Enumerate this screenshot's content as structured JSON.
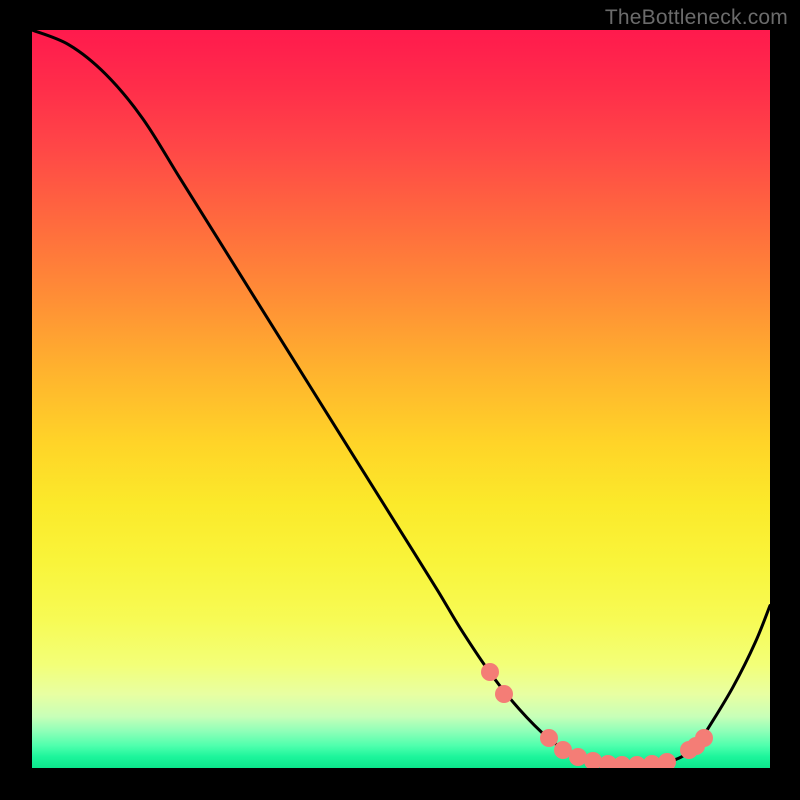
{
  "watermark": "TheBottleneck.com",
  "chart_data": {
    "type": "line",
    "title": "",
    "xlabel": "",
    "ylabel": "",
    "xlim": [
      0,
      100
    ],
    "ylim": [
      0,
      100
    ],
    "grid": false,
    "notes": "Gradient background from red (top) through orange/yellow to green (bottom). Curve is a bottleneck-percentage curve; minimum ~0 near x≈78. Salmon markers cluster along the near-zero flat region.",
    "x": [
      0,
      5,
      10,
      15,
      20,
      25,
      30,
      35,
      40,
      45,
      50,
      55,
      58,
      62,
      66,
      70,
      73,
      74,
      76,
      78,
      80,
      82,
      84,
      86,
      88,
      90,
      92,
      95,
      98,
      100
    ],
    "values": [
      100,
      98,
      94,
      88,
      80,
      72,
      64,
      56,
      48,
      40,
      32,
      24,
      19,
      13,
      8,
      4,
      2,
      1.5,
      1,
      0.6,
      0.4,
      0.4,
      0.5,
      0.8,
      1.5,
      3,
      6,
      11,
      17,
      22
    ],
    "series": [
      {
        "name": "bottleneck",
        "x": [
          0,
          5,
          10,
          15,
          20,
          25,
          30,
          35,
          40,
          45,
          50,
          55,
          58,
          62,
          66,
          70,
          73,
          74,
          76,
          78,
          80,
          82,
          84,
          86,
          88,
          90,
          92,
          95,
          98,
          100
        ],
        "values": [
          100,
          98,
          94,
          88,
          80,
          72,
          64,
          56,
          48,
          40,
          32,
          24,
          19,
          13,
          8,
          4,
          2,
          1.5,
          1,
          0.6,
          0.4,
          0.4,
          0.5,
          0.8,
          1.5,
          3,
          6,
          11,
          17,
          22
        ]
      }
    ],
    "markers": {
      "color": "#f47d76",
      "points": [
        {
          "x": 62,
          "y": 13
        },
        {
          "x": 64,
          "y": 10
        },
        {
          "x": 70,
          "y": 4
        },
        {
          "x": 72,
          "y": 2.5
        },
        {
          "x": 74,
          "y": 1.5
        },
        {
          "x": 76,
          "y": 1
        },
        {
          "x": 78,
          "y": 0.6
        },
        {
          "x": 80,
          "y": 0.4
        },
        {
          "x": 82,
          "y": 0.4
        },
        {
          "x": 84,
          "y": 0.5
        },
        {
          "x": 86,
          "y": 0.8
        },
        {
          "x": 89,
          "y": 2.5
        },
        {
          "x": 90,
          "y": 3
        },
        {
          "x": 91,
          "y": 4
        }
      ]
    }
  }
}
